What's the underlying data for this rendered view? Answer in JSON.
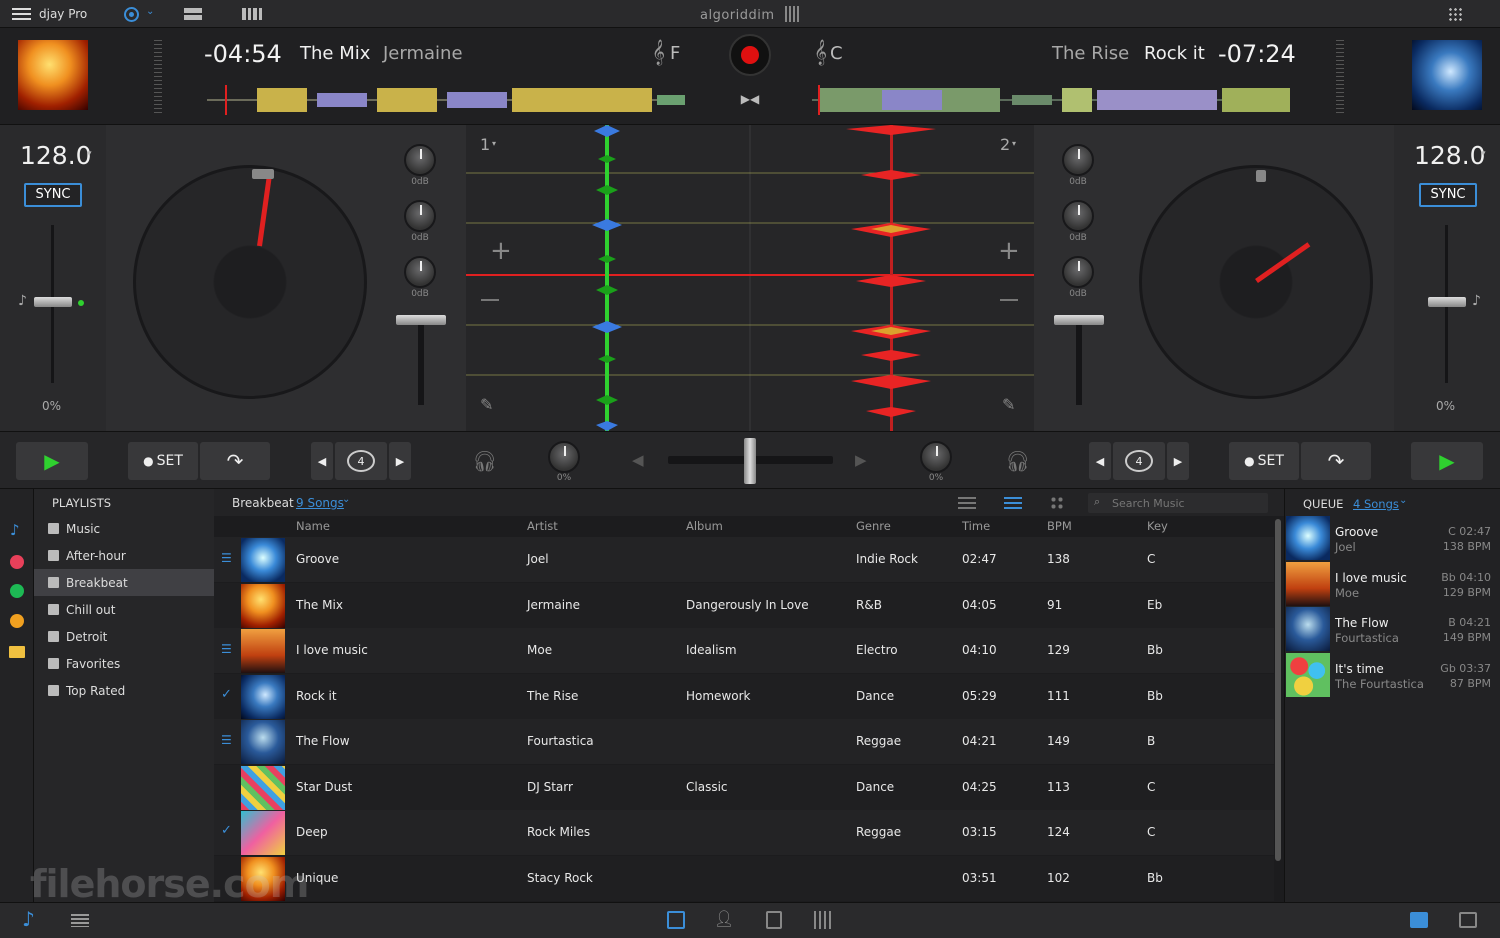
{
  "menubar": {
    "app_name": "djay Pro",
    "logo_text": "algoriddim"
  },
  "deck_left": {
    "time": "-04:54",
    "title": "The Mix",
    "artist": "Jermaine",
    "key": "F",
    "bpm": "128.0",
    "sync_label": "SYNC",
    "pitch_pct": "0%",
    "gain_labels": [
      "0dB",
      "0dB",
      "0dB"
    ],
    "deck_number": "1"
  },
  "deck_right": {
    "time": "-07:24",
    "title": "Rock it",
    "artist": "The Rise",
    "key": "C",
    "bpm": "128.0",
    "sync_label": "SYNC",
    "pitch_pct": "0%",
    "gain_labels": [
      "0dB",
      "0dB",
      "0dB"
    ],
    "deck_number": "2"
  },
  "transport": {
    "set_label": "SET",
    "loop_count": "4",
    "filter_left_pct": "0%",
    "filter_right_pct": "0%"
  },
  "sidebar": {
    "heading": "PLAYLISTS",
    "items": [
      "Music",
      "After-hour",
      "Breakbeat",
      "Chill out",
      "Detroit",
      "Favorites",
      "Top Rated"
    ],
    "selected_index": 2
  },
  "library": {
    "playlist_name": "Breakbeat",
    "song_count": "9 Songs",
    "search_placeholder": "Search Music",
    "columns": [
      "Name",
      "Artist",
      "Album",
      "Genre",
      "Time",
      "BPM",
      "Key"
    ],
    "rows": [
      {
        "name": "Groove",
        "artist": "Joel",
        "album": "",
        "genre": "Indie Rock",
        "time": "02:47",
        "bpm": "138",
        "key": "C",
        "mark": "queue"
      },
      {
        "name": "The Mix",
        "artist": "Jermaine",
        "album": "Dangerously In Love",
        "genre": "R&B",
        "time": "04:05",
        "bpm": "91",
        "key": "Eb",
        "mark": ""
      },
      {
        "name": "I love music",
        "artist": "Moe",
        "album": "Idealism",
        "genre": "Electro",
        "time": "04:10",
        "bpm": "129",
        "key": "Bb",
        "mark": "queue"
      },
      {
        "name": "Rock it",
        "artist": "The Rise",
        "album": "Homework",
        "genre": "Dance",
        "time": "05:29",
        "bpm": "111",
        "key": "Bb",
        "mark": "played"
      },
      {
        "name": "The Flow",
        "artist": "Fourtastica",
        "album": "",
        "genre": "Reggae",
        "time": "04:21",
        "bpm": "149",
        "key": "B",
        "mark": "queue"
      },
      {
        "name": "Star Dust",
        "artist": "DJ Starr",
        "album": "Classic",
        "genre": "Dance",
        "time": "04:25",
        "bpm": "113",
        "key": "C",
        "mark": ""
      },
      {
        "name": "Deep",
        "artist": "Rock Miles",
        "album": "",
        "genre": "Reggae",
        "time": "03:15",
        "bpm": "124",
        "key": "C",
        "mark": "played"
      },
      {
        "name": "Unique",
        "artist": "Stacy Rock",
        "album": "",
        "genre": "",
        "time": "03:51",
        "bpm": "102",
        "key": "Bb",
        "mark": ""
      }
    ]
  },
  "queue": {
    "heading": "QUEUE",
    "count": "4 Songs",
    "items": [
      {
        "title": "Groove",
        "artist": "Joel",
        "key_time": "C 02:47",
        "bpm": "138 BPM"
      },
      {
        "title": "I love music",
        "artist": "Moe",
        "key_time": "Bb 04:10",
        "bpm": "129 BPM"
      },
      {
        "title": "The Flow",
        "artist": "Fourtastica",
        "key_time": "B 04:21",
        "bpm": "149 BPM"
      },
      {
        "title": "It's time",
        "artist": "The Fourtastica",
        "key_time": "Gb 03:37",
        "bpm": "87 BPM"
      }
    ]
  },
  "watermark": "filehorse.com",
  "colors": {
    "accent": "#3b8ed8",
    "play_green": "#2fd12f",
    "record_red": "#e01010"
  }
}
